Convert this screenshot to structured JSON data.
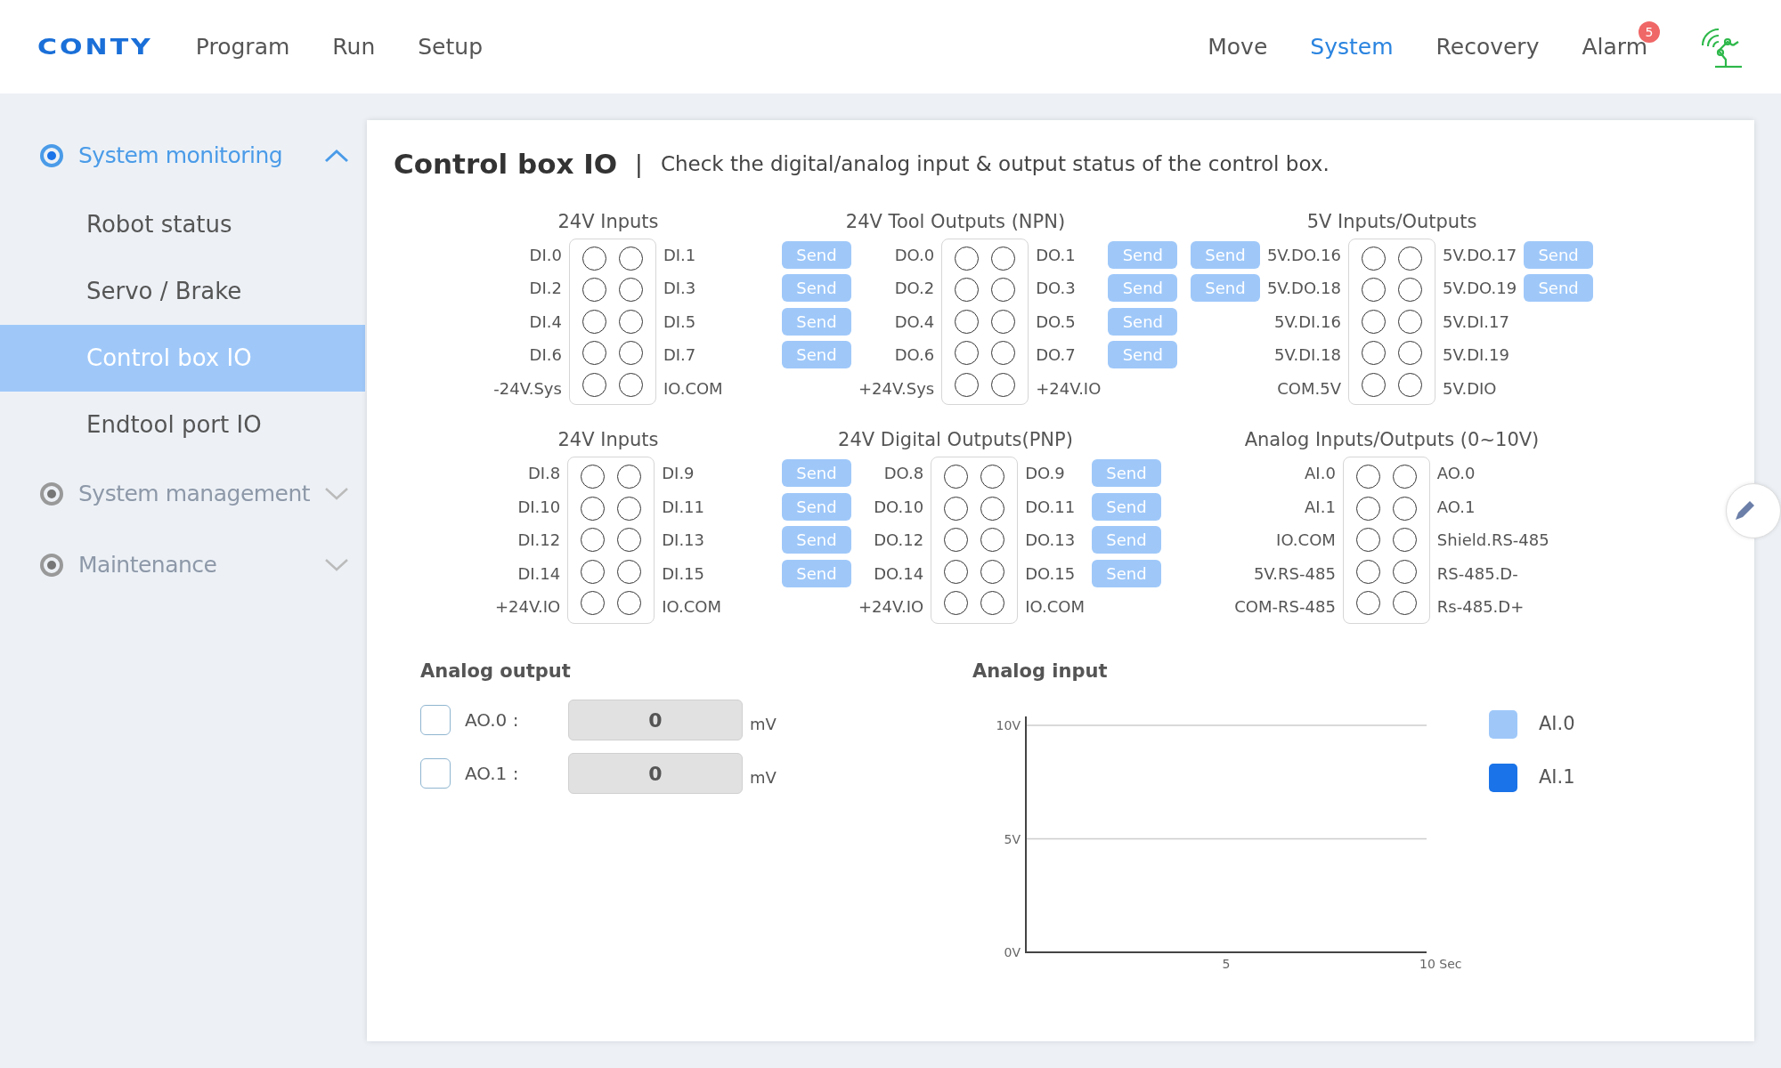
{
  "topbar": {
    "logo": "CONTY",
    "left_nav": [
      {
        "label": "Program",
        "selected": false
      },
      {
        "label": "Run",
        "selected": false
      },
      {
        "label": "Setup",
        "selected": false
      }
    ],
    "right_nav": [
      {
        "label": "Move",
        "selected": false
      },
      {
        "label": "System",
        "selected": true
      },
      {
        "label": "Recovery",
        "selected": false
      },
      {
        "label": "Alarm",
        "selected": false,
        "badge": "5"
      }
    ]
  },
  "sidebar": {
    "sections": [
      {
        "label": "System monitoring",
        "selected": true,
        "expanded": true,
        "children": [
          {
            "label": "Robot status",
            "selected": false
          },
          {
            "label": "Servo / Brake",
            "selected": false
          },
          {
            "label": "Control box IO",
            "selected": true
          },
          {
            "label": "Endtool port IO",
            "selected": false
          }
        ]
      },
      {
        "label": "System management",
        "selected": false,
        "expanded": false
      },
      {
        "label": "Maintenance",
        "selected": false,
        "expanded": false
      }
    ]
  },
  "panel": {
    "title": "Control box IO",
    "separator": "|",
    "description": "Check the digital/analog input & output status of the control box.",
    "io_groups": [
      {
        "title": "24V Inputs",
        "rows": [
          {
            "left": "DI.0",
            "right": "DI.1"
          },
          {
            "left": "DI.2",
            "right": "DI.3"
          },
          {
            "left": "DI.4",
            "right": "DI.5"
          },
          {
            "left": "DI.6",
            "right": "DI.7"
          },
          {
            "left": "-24V.Sys",
            "right": "IO.COM"
          }
        ]
      },
      {
        "title": "24V Tool Outputs (NPN)",
        "rows": [
          {
            "left_button": "Send",
            "left": "DO.0",
            "right": "DO.1",
            "right_button": "Send"
          },
          {
            "left_button": "Send",
            "left": "DO.2",
            "right": "DO.3",
            "right_button": "Send"
          },
          {
            "left_button": "Send",
            "left": "DO.4",
            "right": "DO.5",
            "right_button": "Send"
          },
          {
            "left_button": "Send",
            "left": "DO.6",
            "right": "DO.7",
            "right_button": "Send"
          },
          {
            "left": "+24V.Sys",
            "right": "+24V.IO"
          }
        ]
      },
      {
        "title": "5V Inputs/Outputs",
        "rows": [
          {
            "left_button": "Send",
            "left": "5V.DO.16",
            "right": "5V.DO.17",
            "right_button": "Send"
          },
          {
            "left_button": "Send",
            "left": "5V.DO.18",
            "right": "5V.DO.19",
            "right_button": "Send"
          },
          {
            "left": "5V.DI.16",
            "right": "5V.DI.17"
          },
          {
            "left": "5V.DI.18",
            "right": "5V.DI.19"
          },
          {
            "left": "COM.5V",
            "right": "5V.DIO"
          }
        ]
      },
      {
        "title": "24V Inputs",
        "rows": [
          {
            "left": "DI.8",
            "right": "DI.9"
          },
          {
            "left": "DI.10",
            "right": "DI.11"
          },
          {
            "left": "DI.12",
            "right": "DI.13"
          },
          {
            "left": "DI.14",
            "right": "DI.15"
          },
          {
            "left": "+24V.IO",
            "right": "IO.COM"
          }
        ]
      },
      {
        "title": "24V Digital Outputs(PNP)",
        "rows": [
          {
            "left_button": "Send",
            "left": "DO.8",
            "right": "DO.9",
            "right_button": "Send"
          },
          {
            "left_button": "Send",
            "left": "DO.10",
            "right": "DO.11",
            "right_button": "Send"
          },
          {
            "left_button": "Send",
            "left": "DO.12",
            "right": "DO.13",
            "right_button": "Send"
          },
          {
            "left_button": "Send",
            "left": "DO.14",
            "right": "DO.15",
            "right_button": "Send"
          },
          {
            "left": "+24V.IO",
            "right": "IO.COM"
          }
        ]
      },
      {
        "title": "Analog Inputs/Outputs (0~10V)",
        "rows": [
          {
            "left": "AI.0",
            "right": "AO.0"
          },
          {
            "left": "AI.1",
            "right": "AO.1"
          },
          {
            "left": "IO.COM",
            "right": "Shield.RS-485"
          },
          {
            "left": "5V.RS-485",
            "right": "RS-485.D-"
          },
          {
            "left": "COM-RS-485",
            "right": "Rs-485.D+"
          }
        ]
      }
    ],
    "analog_output": {
      "title": "Analog output",
      "rows": [
        {
          "label": "AO.0 :",
          "checked": false,
          "value": "0",
          "unit": "mV"
        },
        {
          "label": "AO.1 :",
          "checked": false,
          "value": "0",
          "unit": "mV"
        }
      ]
    },
    "analog_input": {
      "title": "Analog input",
      "y_axis_labels": [
        "10V",
        "5V",
        "0V"
      ],
      "x_axis_labels": [
        "5",
        "10 Sec"
      ],
      "legend": [
        {
          "label": "AI.0",
          "color": "#9fc8f9"
        },
        {
          "label": "AI.1",
          "color": "#1a73e8"
        }
      ]
    }
  }
}
